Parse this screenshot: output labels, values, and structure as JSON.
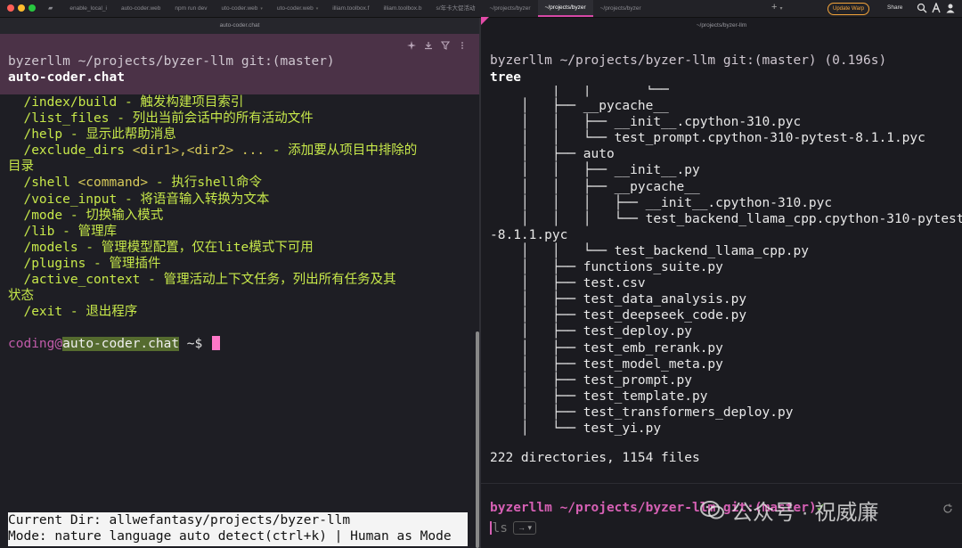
{
  "titlebar": {
    "tabs": [
      {
        "label": "",
        "active": false
      },
      {
        "label": "enable_local_i",
        "active": false
      },
      {
        "label": "auto-coder.web",
        "active": false
      },
      {
        "label": "npm run dev",
        "active": false
      },
      {
        "label": "uto-coder.web",
        "active": false
      },
      {
        "label": "uto-coder.web",
        "active": false
      },
      {
        "label": "illiam.toolbox.f",
        "active": false
      },
      {
        "label": "illiam.toolbox.b",
        "active": false
      },
      {
        "label": "s/年卡大促活动",
        "active": false
      },
      {
        "label": "~/projects/byzer",
        "active": false
      },
      {
        "label": "~/projects/byzer",
        "active": true
      },
      {
        "label": "~/projects/byzer",
        "active": false
      }
    ],
    "update_label": "Update Warp",
    "share_label": "Share"
  },
  "left_pane": {
    "header": "auto-coder.chat",
    "block_command": "byzerllm ~/projects/byzer-llm git:(master)",
    "block_title": "auto-coder.chat",
    "help_lines": [
      {
        "cmd": "  /index/build",
        "sep": " - ",
        "desc": "触发构建项目索引"
      },
      {
        "cmd": "  /list_files",
        "sep": " - ",
        "desc": "列出当前会话中的所有活动文件"
      },
      {
        "cmd": "  /help",
        "sep": " - ",
        "desc": "显示此帮助消息"
      },
      {
        "cmd": "  /exclude_dirs ",
        "arg": "<dir1>,<dir2> ...",
        "sep": " - ",
        "desc": "添加要从项目中排除的"
      },
      {
        "cmd": "目录",
        "sep": "",
        "desc": ""
      },
      {
        "cmd": "  /shell ",
        "arg": "<command>",
        "sep": " - ",
        "desc": "执行shell命令"
      },
      {
        "cmd": "  /voice_input",
        "sep": " - ",
        "desc": "将语音输入转换为文本"
      },
      {
        "cmd": "  /mode",
        "sep": " - ",
        "desc": "切换输入模式"
      },
      {
        "cmd": "  /lib",
        "sep": " - ",
        "desc": "管理库"
      },
      {
        "cmd": "  /models",
        "sep": " - ",
        "desc": "管理模型配置，仅在lite模式下可用"
      },
      {
        "cmd": "  /plugins",
        "sep": " - ",
        "desc": "管理插件"
      },
      {
        "cmd": "  /active_context",
        "sep": " - ",
        "desc": "管理活动上下文任务，列出所有任务及其"
      },
      {
        "cmd": "状态",
        "sep": "",
        "desc": ""
      },
      {
        "cmd": "  /exit",
        "sep": " - ",
        "desc": "退出程序"
      }
    ],
    "prompt": {
      "user": "coding",
      "at": "@",
      "host": "auto-coder.chat",
      "tail": " ~$ "
    },
    "status_lines": [
      "Current Dir: allwefantasy/projects/byzer-llm",
      "Mode: nature language auto detect(ctrl+k) | Human as Mode"
    ]
  },
  "right_pane": {
    "header": "~/projects/byzer-llm",
    "block_command": "byzerllm ~/projects/byzer-llm git:(master) (0.196s)",
    "block_title": "tree",
    "tree_lines": [
      "        │   │       └──",
      "    │   ├── __pycache__",
      "    │   │   ├── __init__.cpython-310.pyc",
      "    │   │   └── test_prompt.cpython-310-pytest-8.1.1.pyc",
      "    │   ├── auto",
      "    │   │   ├── __init__.py",
      "    │   │   ├── __pycache__",
      "    │   │   │   ├── __init__.cpython-310.pyc",
      "    │   │   │   └── test_backend_llama_cpp.cpython-310-pytest",
      "-8.1.1.pyc",
      "    │   │   └── test_backend_llama_cpp.py",
      "    │   ├── functions_suite.py",
      "    │   ├── test.csv",
      "    │   ├── test_data_analysis.py",
      "    │   ├── test_deepseek_code.py",
      "    │   ├── test_deploy.py",
      "    │   ├── test_emb_rerank.py",
      "    │   ├── test_model_meta.py",
      "    │   ├── test_prompt.py",
      "    │   ├── test_template.py",
      "    │   ├── test_transformers_deploy.py",
      "    │   └── test_yi.py"
    ],
    "summary": "222 directories, 1154 files",
    "bottom_prompt": {
      "user": "byzerllm",
      "path": " ~/projects/byzer-llm",
      "git": " git:(",
      "branch": "master",
      "git_close": ")",
      "check": "✓"
    },
    "input_value": "ls",
    "input_hint": "→ ▾"
  },
  "watermark": {
    "text": "公众号 · 祝威廉"
  },
  "colors": {
    "accent": "#d648a6",
    "update": "#f3a43a",
    "block_bg": "#4b3247",
    "help_text": "#c7e84a"
  }
}
